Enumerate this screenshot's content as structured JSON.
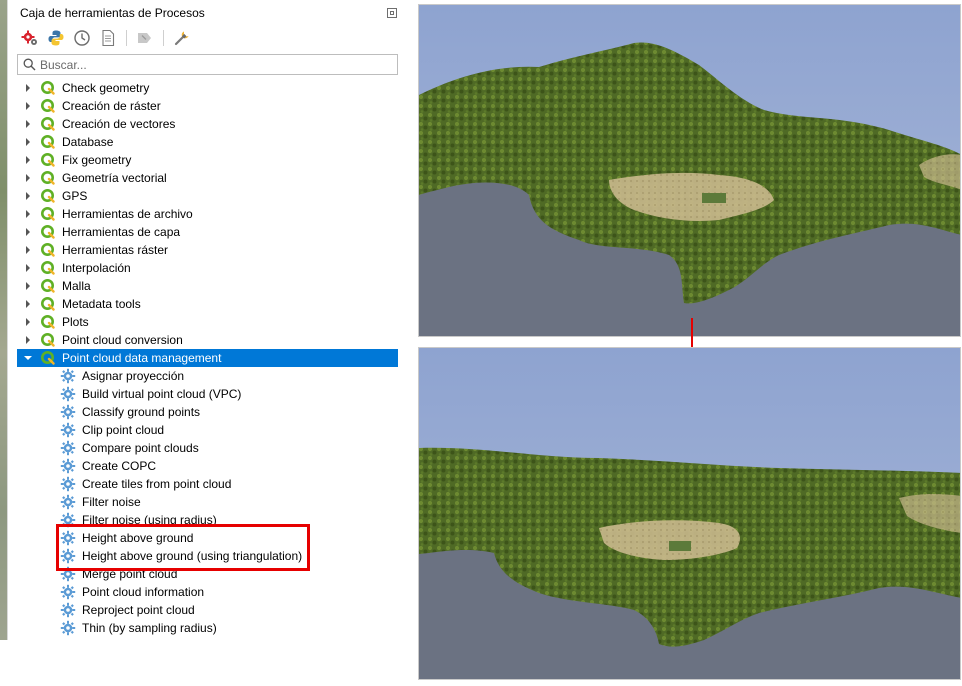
{
  "toolbox": {
    "title": "Caja de herramientas de Procesos",
    "search_placeholder": "Buscar...",
    "toolbar": [
      {
        "icon": "models-gear-icon"
      },
      {
        "icon": "python-icon"
      },
      {
        "icon": "history-clock-icon"
      },
      {
        "icon": "results-document-icon"
      },
      {
        "icon": "edit-in-place-icon"
      },
      {
        "icon": "options-wrench-icon"
      }
    ],
    "groups": [
      {
        "label": "Check geometry"
      },
      {
        "label": "Creación de ráster"
      },
      {
        "label": "Creación de vectores"
      },
      {
        "label": "Database"
      },
      {
        "label": "Fix geometry"
      },
      {
        "label": "Geometría vectorial"
      },
      {
        "label": "GPS"
      },
      {
        "label": "Herramientas de archivo"
      },
      {
        "label": "Herramientas de capa"
      },
      {
        "label": "Herramientas ráster"
      },
      {
        "label": "Interpolación"
      },
      {
        "label": "Malla"
      },
      {
        "label": "Metadata tools"
      },
      {
        "label": "Plots"
      },
      {
        "label": "Point cloud conversion"
      },
      {
        "label": "Point cloud data management",
        "expanded": true,
        "selected": true
      }
    ],
    "algorithms": [
      {
        "label": "Asignar proyección"
      },
      {
        "label": "Build virtual point cloud (VPC)"
      },
      {
        "label": "Classify ground points"
      },
      {
        "label": "Clip point cloud"
      },
      {
        "label": "Compare point clouds"
      },
      {
        "label": "Create COPC"
      },
      {
        "label": "Create tiles from point cloud"
      },
      {
        "label": "Filter noise"
      },
      {
        "label": "Filter noise (using radius)"
      },
      {
        "label": "Height above ground",
        "highlighted": true
      },
      {
        "label": "Height above ground (using triangulation)",
        "highlighted": true
      },
      {
        "label": "Merge point cloud"
      },
      {
        "label": "Point cloud information"
      },
      {
        "label": "Reproject point cloud"
      },
      {
        "label": "Thin (by sampling radius)"
      }
    ]
  },
  "colors": {
    "selection": "#0078d7",
    "highlight": "#e60000",
    "sky": "#9fb2d8",
    "water": "#6b7282",
    "forest": "#4f6a25",
    "sand": "#c9b98c"
  }
}
